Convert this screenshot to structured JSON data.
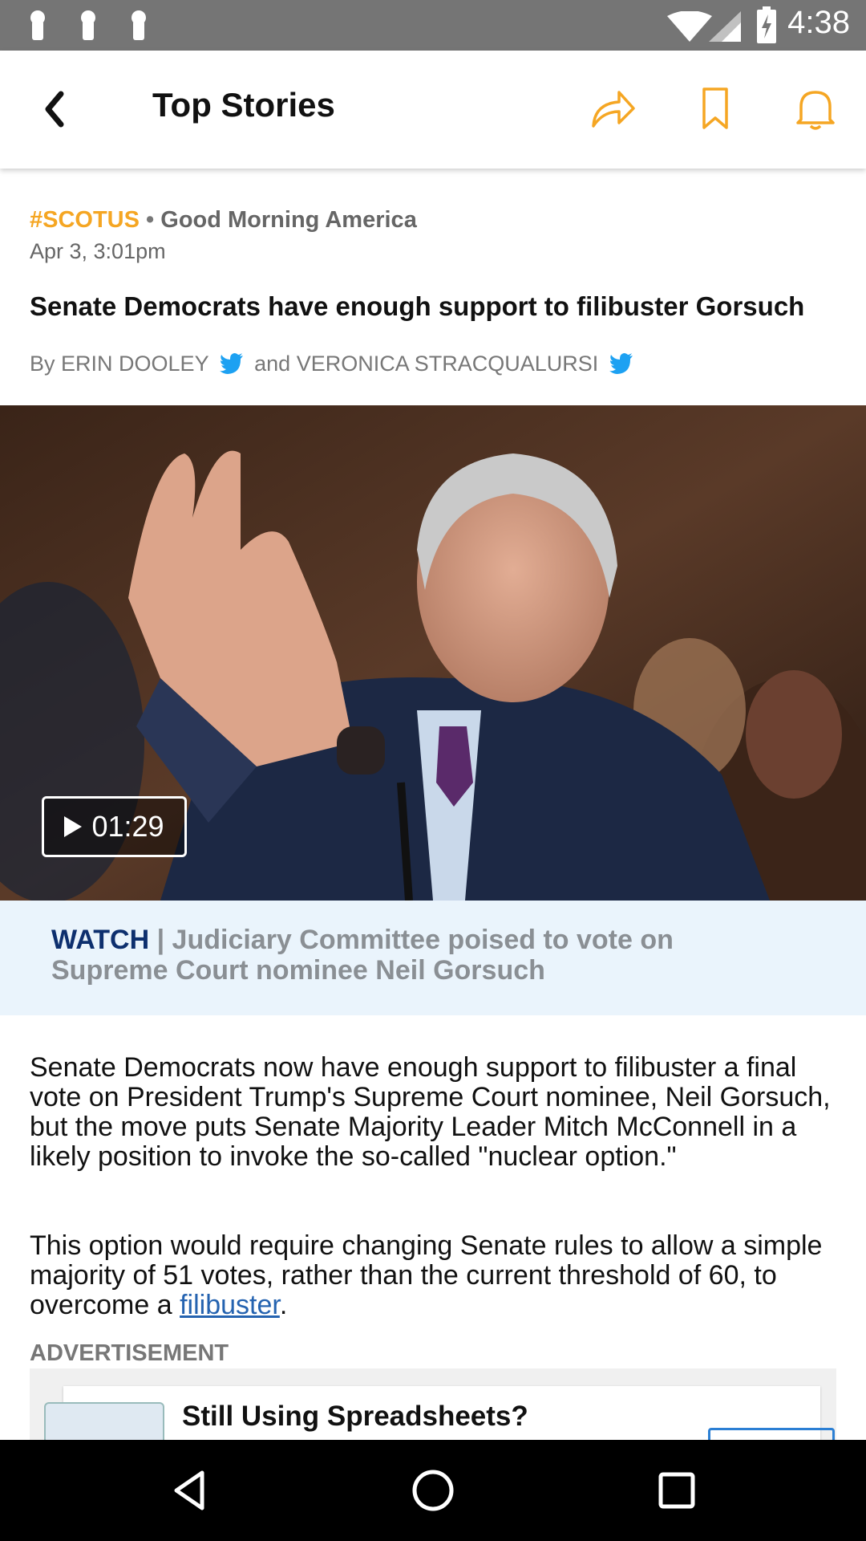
{
  "status_bar": {
    "time": "4:38"
  },
  "app_bar": {
    "title": "Top Stories"
  },
  "article": {
    "tag": "#SCOTUS",
    "separator": "•",
    "source": "Good Morning America",
    "date": "Apr 3, 3:01pm",
    "headline": "Senate Democrats have enough support to filibuster Gorsuch",
    "byline_prefix": "By",
    "author_1": "ERIN DOOLEY",
    "byline_and": "and",
    "author_2": "VERONICA STRACQUALURSI",
    "video_duration": "01:29",
    "watch_label": "WATCH",
    "watch_separator": "|",
    "watch_caption": "Judiciary Committee poised to vote on Supreme Court nominee Neil Gorsuch",
    "paragraph_1": "Senate Democrats now have enough support to filibuster a final vote on President Trump's Supreme Court nominee, Neil Gorsuch, but the move puts Senate Majority Leader Mitch McConnell in a likely position to invoke the so-called \"nuclear option.\"",
    "paragraph_2_text": "This option would require changing Senate rules to allow a simple majority of 51 votes, rather than the current threshold of 60, to overcome a",
    "paragraph_2_link": "filibuster",
    "paragraph_2_end": "."
  },
  "advertisement": {
    "label": "ADVERTISEMENT",
    "title": "Still Using Spreadsheets?"
  },
  "colors": {
    "accent": "#f5a623",
    "watch_label": "#0d2f6e",
    "watch_bg": "#eaf4fc",
    "link": "#2563b0",
    "twitter": "#1da1f2"
  }
}
